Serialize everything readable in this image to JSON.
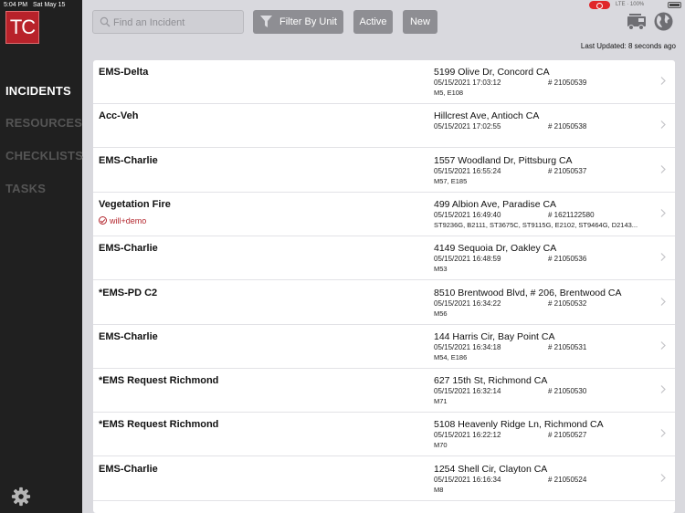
{
  "status_bar": {
    "time": "5:04 PM",
    "date": "Sat May 15",
    "network": "LTE",
    "battery": "100%"
  },
  "app": {
    "logo_text": "TC",
    "brand_color": "#b8222a"
  },
  "sidebar": {
    "items": [
      {
        "label": "INCIDENTS",
        "active": true
      },
      {
        "label": "RESOURCES",
        "active": false
      },
      {
        "label": "CHECKLISTS",
        "active": false
      },
      {
        "label": "TASKS",
        "active": false
      }
    ],
    "settings_icon": "gear-icon"
  },
  "toolbar": {
    "search_placeholder": "Find an Incident",
    "filter_label": "Filter By Unit",
    "active_label": "Active",
    "new_label": "New",
    "truck_icon": "fire-truck-icon",
    "globe_icon": "globe-icon"
  },
  "last_updated": "Last Updated: 8 seconds ago",
  "incidents": [
    {
      "type": "EMS-Delta",
      "address": "5199 Olive Dr, Concord CA",
      "datetime": "05/15/2021 17:03:12",
      "number": "# 21050539",
      "units": "M5, E108",
      "user": ""
    },
    {
      "type": "Acc-Veh",
      "address": "Hillcrest Ave, Antioch CA",
      "datetime": "05/15/2021 17:02:55",
      "number": "# 21050538",
      "units": "",
      "user": ""
    },
    {
      "type": "EMS-Charlie",
      "address": "1557 Woodland Dr, Pittsburg CA",
      "datetime": "05/15/2021 16:55:24",
      "number": "# 21050537",
      "units": "M57, E185",
      "user": ""
    },
    {
      "type": "Vegetation Fire",
      "address": "499 Albion Ave, Paradise CA",
      "datetime": "05/15/2021 16:49:40",
      "number": "# 1621122580",
      "units": "ST9236G, B2111, ST3675C, ST9115G, E2102, ST9464G, D2143...",
      "user": "will+demo"
    },
    {
      "type": "EMS-Charlie",
      "address": "4149 Sequoia Dr, Oakley CA",
      "datetime": "05/15/2021 16:48:59",
      "number": "# 21050536",
      "units": "M53",
      "user": ""
    },
    {
      "type": "*EMS-PD C2",
      "address": "8510 Brentwood Blvd, # 206, Brentwood CA",
      "datetime": "05/15/2021 16:34:22",
      "number": "# 21050532",
      "units": "M56",
      "user": ""
    },
    {
      "type": "EMS-Charlie",
      "address": "144 Harris Cir, Bay Point CA",
      "datetime": "05/15/2021 16:34:18",
      "number": "# 21050531",
      "units": "M54, E186",
      "user": ""
    },
    {
      "type": "*EMS Request Richmond",
      "address": "627 15th St, Richmond CA",
      "datetime": "05/15/2021 16:32:14",
      "number": "# 21050530",
      "units": "M71",
      "user": ""
    },
    {
      "type": "*EMS Request Richmond",
      "address": "5108 Heavenly Ridge Ln, Richmond CA",
      "datetime": "05/15/2021 16:22:12",
      "number": "# 21050527",
      "units": "M70",
      "user": ""
    },
    {
      "type": "EMS-Charlie",
      "address": "1254 Shell Cir, Clayton CA",
      "datetime": "05/15/2021 16:16:34",
      "number": "# 21050524",
      "units": "M8",
      "user": ""
    }
  ]
}
